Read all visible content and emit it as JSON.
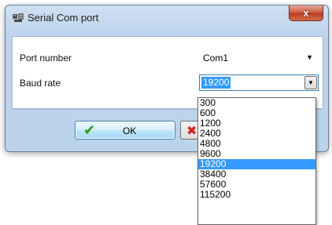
{
  "window": {
    "title": "Serial Com port",
    "close_glyph": "x"
  },
  "fields": {
    "port_label": "Port number",
    "port_value": "Com1",
    "baud_label": "Baud rate",
    "baud_value": "19200"
  },
  "buttons": {
    "ok_label": "OK",
    "ok_icon": "checkmark-icon",
    "cancel_icon": "x-cancel-icon"
  },
  "baud_options": [
    "300",
    "600",
    "1200",
    "2400",
    "4800",
    "9600",
    "19200",
    "38400",
    "57600",
    "115200"
  ],
  "selected_index": 6,
  "colors": {
    "selection": "#3399ff",
    "ok_check": "#2c9a0a",
    "cancel_x": "#d0251a",
    "close_button": "#c9583f"
  }
}
